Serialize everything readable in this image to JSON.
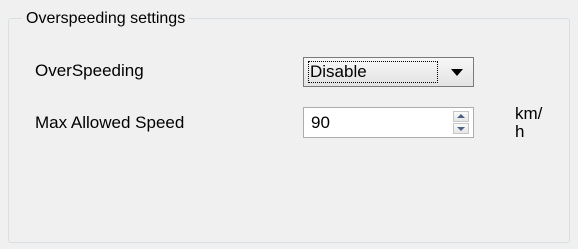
{
  "group": {
    "title": "Overspeeding settings"
  },
  "overspeeding": {
    "label": "OverSpeeding",
    "selected": "Disable"
  },
  "max_speed": {
    "label": "Max Allowed Speed",
    "value": "90",
    "unit_line1": "km/",
    "unit_line2": "h"
  },
  "icons": {
    "combo_arrow": "chevron-down-icon",
    "spin_up": "arrow-up-icon",
    "spin_down": "arrow-down-icon"
  }
}
